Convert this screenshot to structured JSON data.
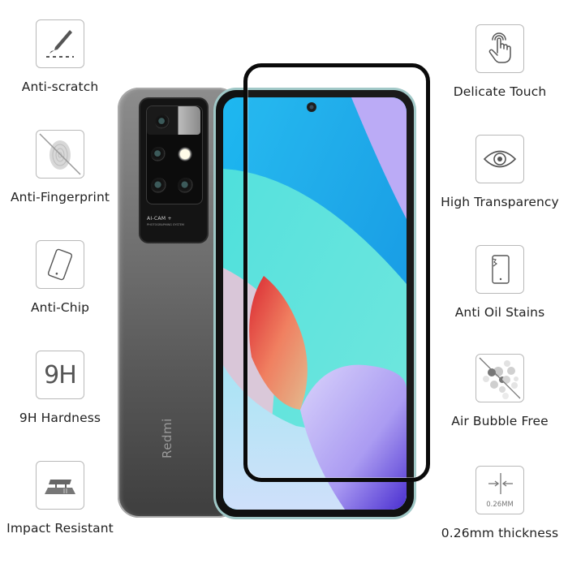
{
  "product": {
    "brand_text": "Redmi",
    "camera_label": "AI-CAM +",
    "camera_sublabel": "PHOTOGRAPHING SYSTEM"
  },
  "features_left": [
    {
      "label": "Anti-scratch",
      "icon": "blade-scratch-icon"
    },
    {
      "label": "Anti-Fingerprint",
      "icon": "fingerprint-crossed-icon"
    },
    {
      "label": "Anti-Chip",
      "icon": "tilted-phone-icon"
    },
    {
      "label": "9H Hardness",
      "icon": "9h-icon",
      "icon_text": "9H"
    },
    {
      "label": "Impact Resistant",
      "icon": "layered-plates-icon"
    }
  ],
  "features_right": [
    {
      "label": "Delicate Touch",
      "icon": "touch-hand-icon"
    },
    {
      "label": "High Transparency",
      "icon": "eye-icon"
    },
    {
      "label": "Anti Oil Stains",
      "icon": "phone-corner-chip-icon"
    },
    {
      "label": "Air Bubble Free",
      "icon": "bubbles-crossed-icon"
    },
    {
      "label": "0.26mm thickness",
      "icon": "thickness-arrows-icon",
      "icon_text": "0.26MM"
    }
  ],
  "colors": {
    "icon_stroke": "#555555",
    "icon_border": "#b9b9b9",
    "label_text": "#222222",
    "glass_frame": "#0a0a0a",
    "screen_blue": "#19b6ee",
    "screen_teal": "#5fe0dc",
    "screen_violet": "#b7a6f5",
    "screen_red": "#e0312c"
  }
}
